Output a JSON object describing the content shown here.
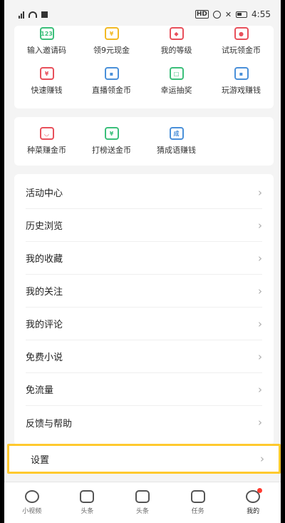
{
  "status_bar": {
    "time": "4:55",
    "hd": "HD"
  },
  "colors": {
    "accent_yellow": "#ffc92e",
    "green": "#3bbf7a",
    "red": "#e8505b",
    "blue": "#4a90d9",
    "badge_red": "#ff3b30"
  },
  "grid1": {
    "row1": [
      {
        "label": "输入邀请码",
        "icon": "invite-code-icon",
        "glyph": "123",
        "color": "#3bbf7a"
      },
      {
        "label": "领9元现金",
        "icon": "cash-heart-icon",
        "glyph": "¥",
        "color": "#f2b924"
      },
      {
        "label": "我的等级",
        "icon": "level-diamond-icon",
        "glyph": "◆",
        "color": "#e8505b"
      },
      {
        "label": "试玩领金币",
        "icon": "robot-icon",
        "glyph": "●",
        "color": "#e8505b"
      }
    ],
    "row2": [
      {
        "label": "快速赚钱",
        "icon": "money-bag-icon",
        "glyph": "¥",
        "color": "#e8505b"
      },
      {
        "label": "直播领金币",
        "icon": "live-tv-icon",
        "glyph": "▪",
        "color": "#4a90d9"
      },
      {
        "label": "幸运抽奖",
        "icon": "lottery-icon",
        "glyph": "□",
        "color": "#3bbf7a"
      },
      {
        "label": "玩游戏赚钱",
        "icon": "gamepad-icon",
        "glyph": "▪",
        "color": "#4a90d9"
      }
    ]
  },
  "grid2": [
    {
      "label": "种菜赚金币",
      "icon": "plant-icon",
      "glyph": "◡",
      "color": "#e8505b"
    },
    {
      "label": "打榜送金币",
      "icon": "ranking-icon",
      "glyph": "¥",
      "color": "#3bbf7a"
    },
    {
      "label": "猜成语赚钱",
      "icon": "idiom-icon",
      "glyph": "成",
      "color": "#4a90d9"
    }
  ],
  "menu": [
    {
      "label": "活动中心"
    },
    {
      "label": "历史浏览"
    },
    {
      "label": "我的收藏"
    },
    {
      "label": "我的关注"
    },
    {
      "label": "我的评论"
    },
    {
      "label": "免费小说"
    },
    {
      "label": "免流量"
    },
    {
      "label": "反馈与帮助"
    }
  ],
  "settings": {
    "label": "设置"
  },
  "chevron": "›",
  "tabs": [
    {
      "label": "小视频",
      "icon": "video-play-icon"
    },
    {
      "label": "头条",
      "icon": "news-icon"
    },
    {
      "label": "头条",
      "icon": "play-icon"
    },
    {
      "label": "任务",
      "icon": "task-calendar-icon"
    },
    {
      "label": "我的",
      "icon": "profile-icon"
    }
  ]
}
